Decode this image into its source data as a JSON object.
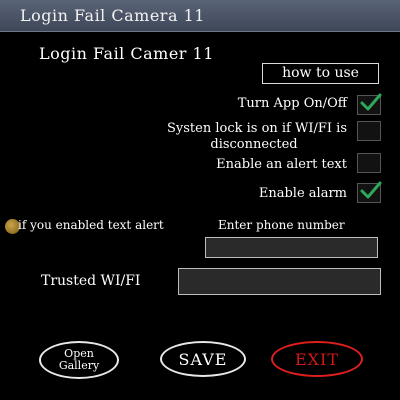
{
  "window": {
    "title": "Login Fail Camera 11"
  },
  "settings": {
    "heading": "Login Fail Camer 11",
    "how_to_use_label": "how to use",
    "turn_app_label": "Turn App On/Off",
    "turn_app_checked": true,
    "system_lock_line1": "Systen lock is on if WI/FI is",
    "system_lock_line2": "disconnected",
    "system_lock_checked": false,
    "alert_text_label": "Enable an alert text",
    "alert_text_checked": false,
    "alarm_label": "Enable alarm",
    "alarm_checked": true,
    "text_alert_hint": "if you enabled text alert",
    "phone_label": "Enter phone number",
    "phone_value": "",
    "trusted_wifi_label": "Trusted WI/FI",
    "trusted_wifi_value": ""
  },
  "actions": {
    "gallery_line1": "Open",
    "gallery_line2": "Gallery",
    "save_label": "SAVE",
    "exit_label": "EXIT"
  },
  "colors": {
    "background": "#000000",
    "titlebar": "#4a5366",
    "checkmark": "#2fa85a",
    "exit": "#d11818",
    "info_dot": "#b08a2e"
  }
}
